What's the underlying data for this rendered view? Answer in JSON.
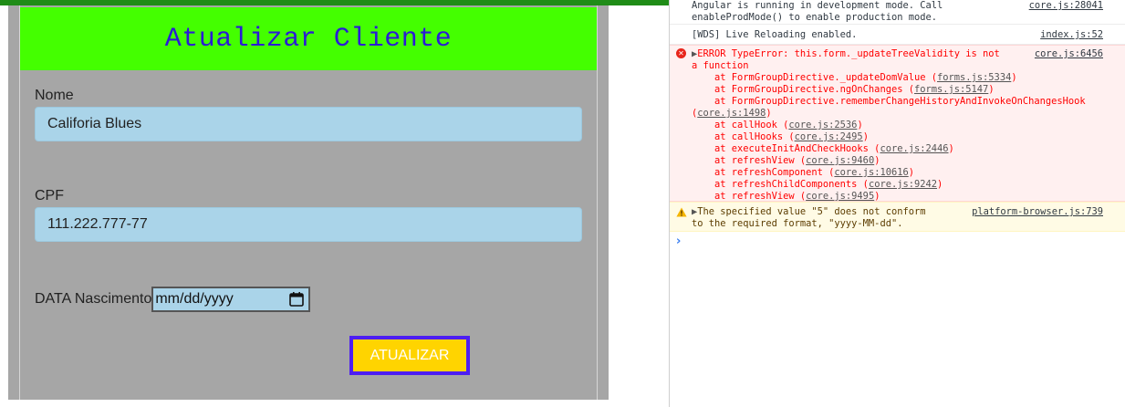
{
  "app": {
    "title": "Atualizar Cliente",
    "fields": {
      "nome_label": "Nome",
      "nome_value": "Califoria Blues",
      "cpf_label": "CPF",
      "cpf_value": "111.222.777-77",
      "data_label": "DATA Nascimento",
      "data_value": "mm/dd/yyyy"
    },
    "submit_label": "ATUALIZAR",
    "colors": {
      "header_bg": "#44ff00",
      "title": "#2b1bd6",
      "input_bg": "#aad4e9",
      "button_bg": "#ffd400",
      "button_border": "#4d1ef2",
      "panel_bg": "#a6a6a6"
    }
  },
  "console": {
    "messages": [
      {
        "level": "info",
        "line1": "Angular is running in development mode. Call",
        "line2": "enableProdMode() to enable production mode.",
        "source": "core.js:28041"
      },
      {
        "level": "info",
        "line1": "[WDS] Live Reloading enabled.",
        "source": "index.js:52"
      },
      {
        "level": "error",
        "line1": "ERROR TypeError: this.form._updateTreeValidity is not",
        "line2": "a function",
        "source": "core.js:6456",
        "stack": [
          {
            "text": "    at FormGroupDirective._updateDomValue (",
            "link": "forms.js:5334",
            "end": ")"
          },
          {
            "text": "    at FormGroupDirective.ngOnChanges (",
            "link": "forms.js:5147",
            "end": ")"
          },
          {
            "text": "    at FormGroupDirective.rememberChangeHistoryAndInvokeOnChangesHook",
            "link": "",
            "end": ""
          },
          {
            "text": "(",
            "link": "core.js:1498",
            "end": ")"
          },
          {
            "text": "    at callHook (",
            "link": "core.js:2536",
            "end": ")"
          },
          {
            "text": "    at callHooks (",
            "link": "core.js:2495",
            "end": ")"
          },
          {
            "text": "    at executeInitAndCheckHooks (",
            "link": "core.js:2446",
            "end": ")"
          },
          {
            "text": "    at refreshView (",
            "link": "core.js:9460",
            "end": ")"
          },
          {
            "text": "    at refreshComponent (",
            "link": "core.js:10616",
            "end": ")"
          },
          {
            "text": "    at refreshChildComponents (",
            "link": "core.js:9242",
            "end": ")"
          },
          {
            "text": "    at refreshView (",
            "link": "core.js:9495",
            "end": ")"
          }
        ]
      },
      {
        "level": "warning",
        "line1": "The specified value \"5\" does not conform",
        "line2": "to the required format, \"yyyy-MM-dd\".",
        "source": "platform-browser.js:739"
      }
    ],
    "prompt": "›"
  }
}
